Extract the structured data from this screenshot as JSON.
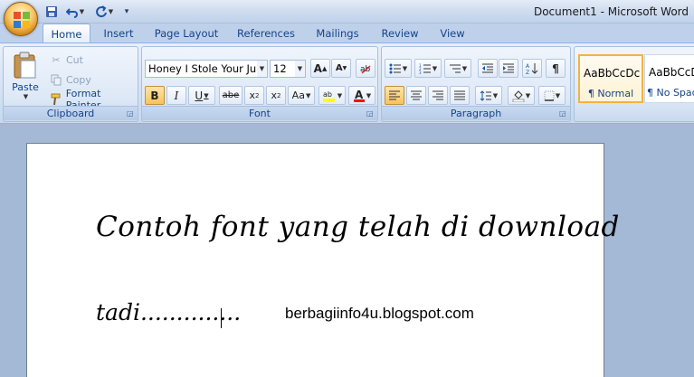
{
  "window": {
    "title": "Document1 - Microsoft Word"
  },
  "quick_access": {
    "items": [
      "save-icon",
      "undo-icon",
      "redo-icon",
      "customize-icon"
    ]
  },
  "tabs": [
    {
      "label": "Home",
      "active": true
    },
    {
      "label": "Insert"
    },
    {
      "label": "Page Layout"
    },
    {
      "label": "References"
    },
    {
      "label": "Mailings"
    },
    {
      "label": "Review"
    },
    {
      "label": "View"
    }
  ],
  "clipboard": {
    "group_label": "Clipboard",
    "paste": "Paste",
    "cut": "Cut",
    "copy": "Copy",
    "format_painter": "Format Painter"
  },
  "font": {
    "group_label": "Font",
    "family": "Honey I Stole Your Jum",
    "size": "12"
  },
  "paragraph": {
    "group_label": "Paragraph"
  },
  "styles": [
    {
      "sample": "AaBbCcDc",
      "name": "¶ Normal",
      "selected": true
    },
    {
      "sample": "AaBbCcDc",
      "name": "¶ No Spaci"
    }
  ],
  "document": {
    "line1": "Contoh font yang telah di download",
    "line2": "tadi..............",
    "watermark": "berbagiinfo4u.blogspot.com"
  },
  "colors": {
    "ribbon_accent": "#15428b",
    "highlight": "#ffff00",
    "font_color": "#ff0000",
    "selected_style": "#f0b440"
  }
}
